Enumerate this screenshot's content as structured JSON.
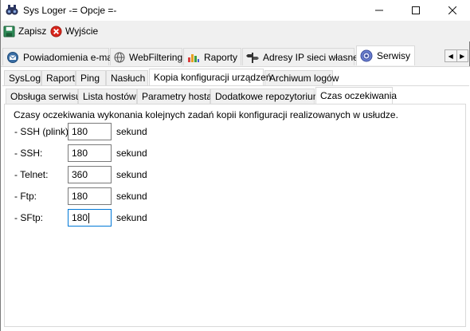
{
  "window": {
    "title": "Sys Loger -= Opcje =-",
    "min_symbol": "—",
    "max_symbol": "☐",
    "close_symbol": "✕"
  },
  "toolbar": {
    "save_label": "Zapisz",
    "exit_label": "Wyjście"
  },
  "main_tabs": [
    {
      "label": "Powiadomienia e-mail",
      "icon": "envelope-icon"
    },
    {
      "label": "WebFiltering",
      "icon": "globe-icon"
    },
    {
      "label": "Raporty",
      "icon": "chart-icon"
    },
    {
      "label": "Adresy IP sieci własnej",
      "icon": "signpost-icon"
    },
    {
      "label": "Serwisy",
      "icon": "settings-icon",
      "active": true
    }
  ],
  "sub_tabs": [
    {
      "label": "SysLog"
    },
    {
      "label": "Raport"
    },
    {
      "label": "Ping"
    },
    {
      "label": "Nasłuch"
    },
    {
      "label": "Kopia konfiguracji urządzeń",
      "active": true
    },
    {
      "label": "Archiwum logów"
    }
  ],
  "inner_tabs": [
    {
      "label": "Obsługa serwisu"
    },
    {
      "label": "Lista hostów"
    },
    {
      "label": "Parametry hosta"
    },
    {
      "label": "Dodatkowe repozytorium"
    },
    {
      "label": "Czas oczekiwania",
      "active": true
    }
  ],
  "timeouts": {
    "description": "Czasy oczekiwania wykonania kolejnych zadań kopii konfiguracji realizowanych w usłudze.",
    "unit": "sekund",
    "fields": [
      {
        "label": "- SSH (plink):",
        "value": "180"
      },
      {
        "label": "- SSH:",
        "value": "180"
      },
      {
        "label": "- Telnet:",
        "value": "360"
      },
      {
        "label": "- Ftp:",
        "value": "180"
      },
      {
        "label": "- SFtp:",
        "value": "180",
        "focused": true
      }
    ]
  },
  "colors": {
    "accent": "#0078d7",
    "tab_border": "#d9d9d9"
  }
}
